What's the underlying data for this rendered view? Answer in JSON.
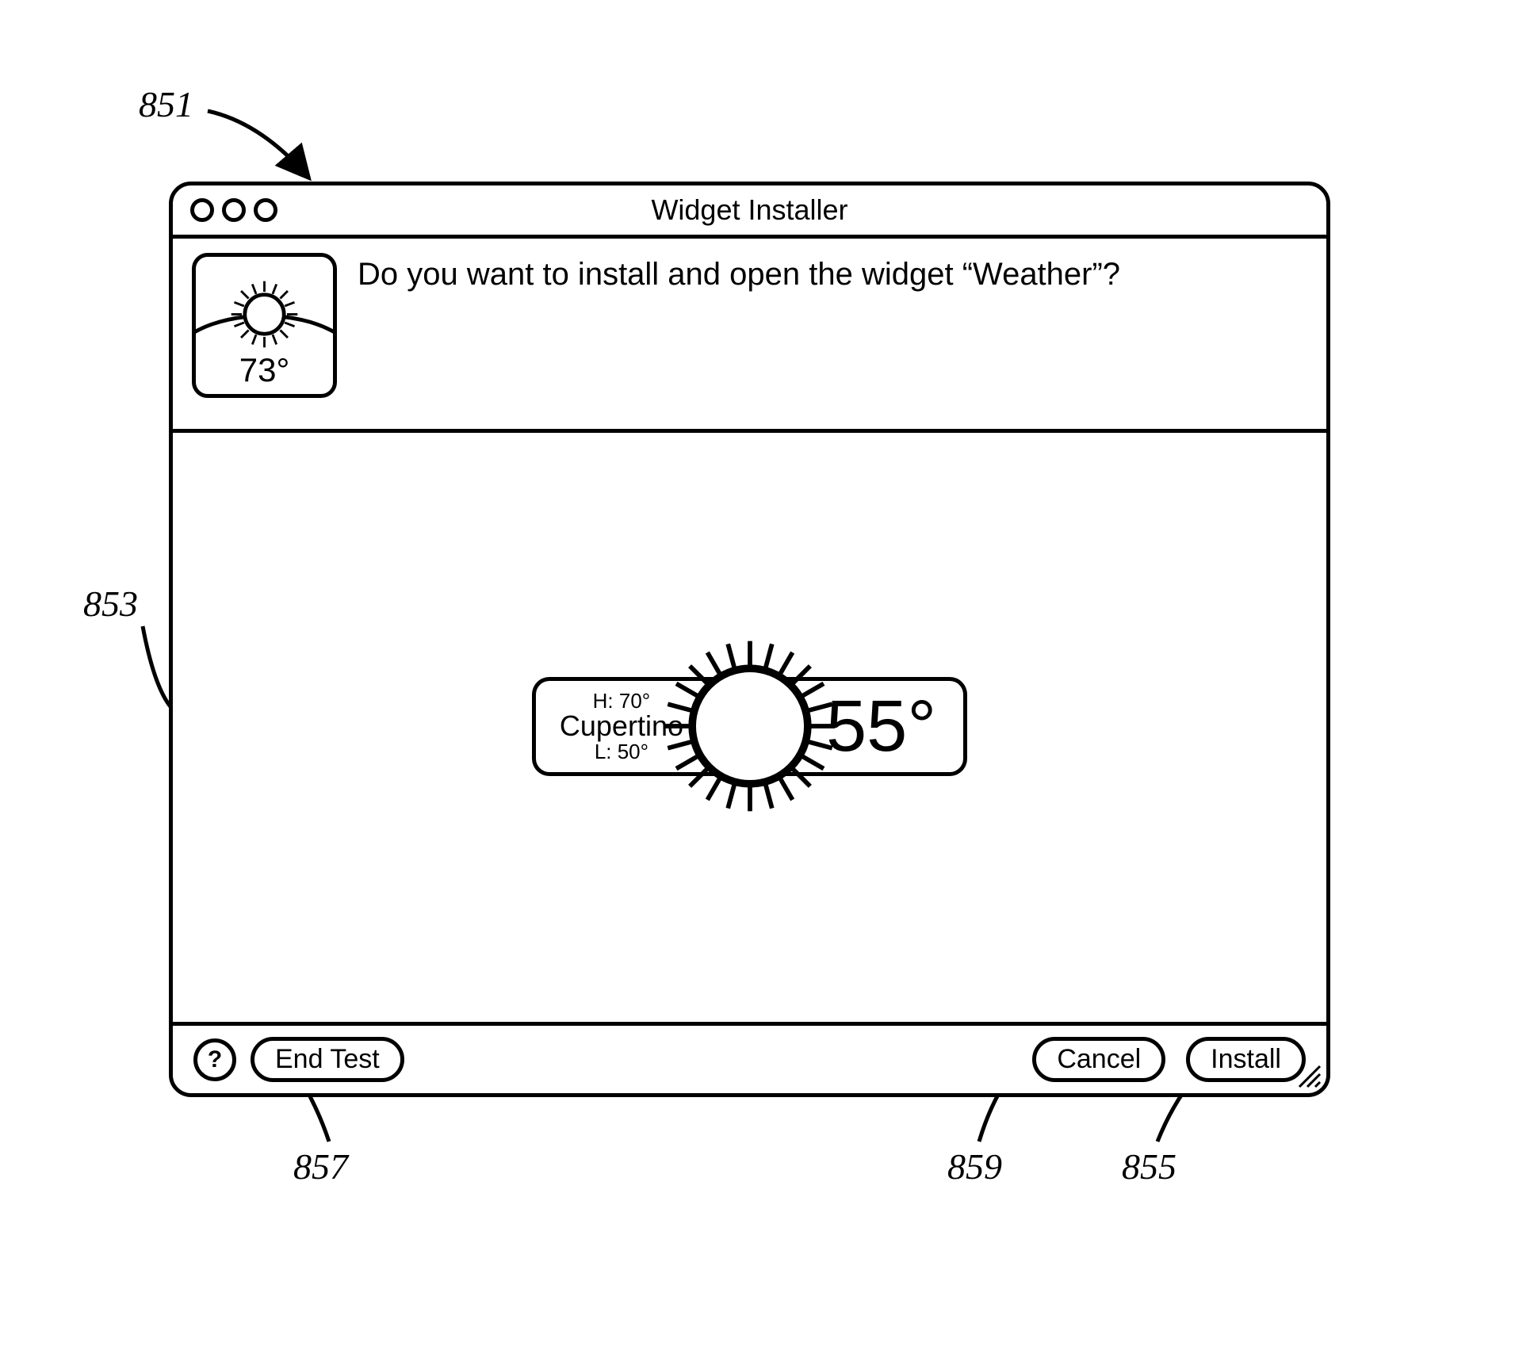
{
  "figure": {
    "ref_main": "851",
    "ref_preview": "853",
    "ref_endtest": "857",
    "ref_cancel": "859",
    "ref_install": "855"
  },
  "window": {
    "title": "Widget Installer",
    "prompt": "Do you want to install and open the widget “Weather”?",
    "thumb_temp": "73°"
  },
  "preview": {
    "high": "H: 70°",
    "city": "Cupertino",
    "low": "L: 50°",
    "current": "55°"
  },
  "footer": {
    "help": "?",
    "end_test": "End Test",
    "cancel": "Cancel",
    "install": "Install"
  }
}
